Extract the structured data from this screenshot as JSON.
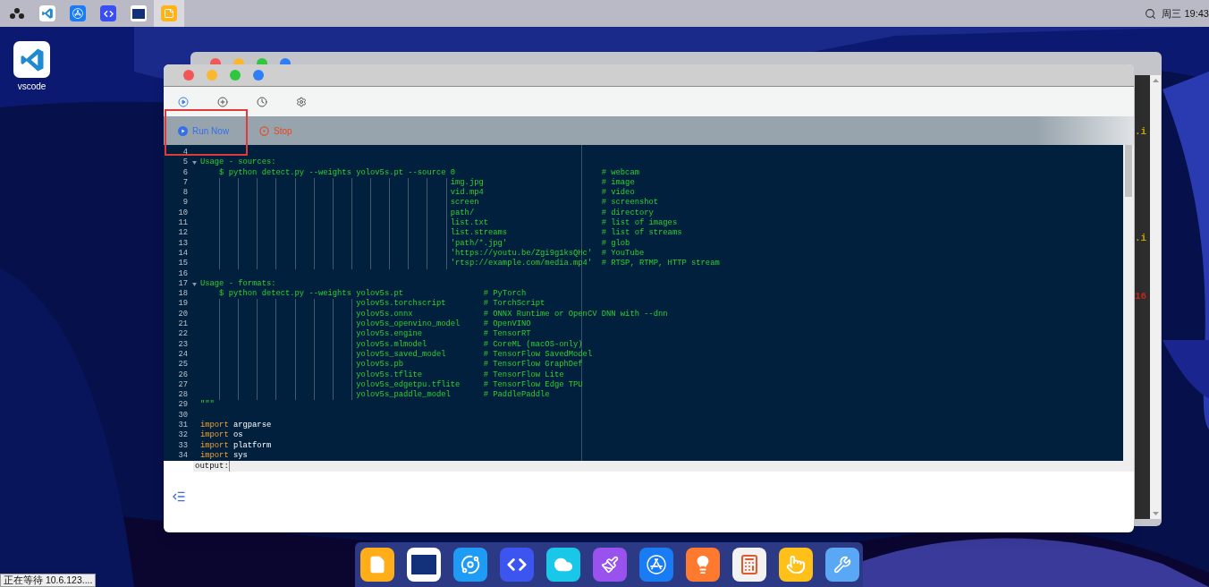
{
  "top_bar": {
    "apps": [
      {
        "kind": "launcher",
        "selected": false
      },
      {
        "kind": "vscode",
        "selected": false
      },
      {
        "kind": "appstore",
        "selected": false
      },
      {
        "kind": "code",
        "selected": false
      },
      {
        "kind": "terminal",
        "selected": false
      },
      {
        "kind": "notes",
        "selected": true
      }
    ],
    "clock": "周三 19:43"
  },
  "desktop_icons": [
    {
      "kind": "vscode",
      "label": "vscode"
    }
  ],
  "back_window": {
    "fragments": [
      {
        "text": ".i",
        "kind": "string"
      },
      {
        "text": ".i",
        "kind": "string"
      },
      {
        "text": "16",
        "kind": "number"
      }
    ]
  },
  "window": {
    "toolbar": [
      {
        "kind": "run",
        "selected": true
      },
      {
        "kind": "add",
        "selected": false
      },
      {
        "kind": "history",
        "selected": false
      },
      {
        "kind": "settings",
        "selected": false
      }
    ],
    "actions": [
      {
        "kind": "run",
        "label": "Run Now"
      },
      {
        "kind": "stop",
        "label": "Stop"
      }
    ],
    "editor": {
      "lines": [
        {
          "n": "4",
          "fold": false
        },
        {
          "n": "5",
          "fold": true,
          "segments": [
            {
              "kind": "doc",
              "text": "Usage - sources:"
            }
          ]
        },
        {
          "n": "6",
          "fold": false,
          "segments": [
            {
              "kind": "doc",
              "text": "    $ python detect.py --weights yolov5s.pt --source 0                               # webcam"
            }
          ]
        },
        {
          "n": "7",
          "fold": false,
          "segments": [
            {
              "kind": "doc",
              "text": "                                                     img.jpg                         # image"
            }
          ]
        },
        {
          "n": "8",
          "fold": false,
          "segments": [
            {
              "kind": "doc",
              "text": "                                                     vid.mp4                         # video"
            }
          ]
        },
        {
          "n": "9",
          "fold": false,
          "segments": [
            {
              "kind": "doc",
              "text": "                                                     screen                          # screenshot"
            }
          ]
        },
        {
          "n": "10",
          "fold": false,
          "segments": [
            {
              "kind": "doc",
              "text": "                                                     path/                           # directory"
            }
          ]
        },
        {
          "n": "11",
          "fold": false,
          "segments": [
            {
              "kind": "doc",
              "text": "                                                     list.txt                        # list of images"
            }
          ]
        },
        {
          "n": "12",
          "fold": false,
          "segments": [
            {
              "kind": "doc",
              "text": "                                                     list.streams                    # list of streams"
            }
          ]
        },
        {
          "n": "13",
          "fold": false,
          "segments": [
            {
              "kind": "doc",
              "text": "                                                     'path/*.jpg'                    # glob"
            }
          ]
        },
        {
          "n": "14",
          "fold": false,
          "segments": [
            {
              "kind": "doc",
              "text": "                                                     'https://youtu.be/Zgi9g1ksQHc'  # YouTube"
            }
          ]
        },
        {
          "n": "15",
          "fold": false,
          "segments": [
            {
              "kind": "doc",
              "text": "                                                     'rtsp://example.com/media.mp4'  # RTSP, RTMP, HTTP stream"
            }
          ]
        },
        {
          "n": "16",
          "fold": false
        },
        {
          "n": "17",
          "fold": true,
          "segments": [
            {
              "kind": "doc",
              "text": "Usage - formats:"
            }
          ]
        },
        {
          "n": "18",
          "fold": false,
          "segments": [
            {
              "kind": "doc",
              "text": "    $ python detect.py --weights yolov5s.pt                 # PyTorch"
            }
          ]
        },
        {
          "n": "19",
          "fold": false,
          "segments": [
            {
              "kind": "doc",
              "text": "                                 yolov5s.torchscript        # TorchScript"
            }
          ]
        },
        {
          "n": "20",
          "fold": false,
          "segments": [
            {
              "kind": "doc",
              "text": "                                 yolov5s.onnx               # ONNX Runtime or OpenCV DNN with --dnn"
            }
          ]
        },
        {
          "n": "21",
          "fold": false,
          "segments": [
            {
              "kind": "doc",
              "text": "                                 yolov5s_openvino_model     # OpenVINO"
            }
          ]
        },
        {
          "n": "22",
          "fold": false,
          "segments": [
            {
              "kind": "doc",
              "text": "                                 yolov5s.engine             # TensorRT"
            }
          ]
        },
        {
          "n": "23",
          "fold": false,
          "segments": [
            {
              "kind": "doc",
              "text": "                                 yolov5s.mlmodel            # CoreML (macOS-only)"
            }
          ]
        },
        {
          "n": "24",
          "fold": false,
          "segments": [
            {
              "kind": "doc",
              "text": "                                 yolov5s_saved_model        # TensorFlow SavedModel"
            }
          ]
        },
        {
          "n": "25",
          "fold": false,
          "segments": [
            {
              "kind": "doc",
              "text": "                                 yolov5s.pb                 # TensorFlow GraphDef"
            }
          ]
        },
        {
          "n": "26",
          "fold": false,
          "segments": [
            {
              "kind": "doc",
              "text": "                                 yolov5s.tflite             # TensorFlow Lite"
            }
          ]
        },
        {
          "n": "27",
          "fold": false,
          "segments": [
            {
              "kind": "doc",
              "text": "                                 yolov5s_edgetpu.tflite     # TensorFlow Edge TPU"
            }
          ]
        },
        {
          "n": "28",
          "fold": false,
          "segments": [
            {
              "kind": "doc",
              "text": "                                 yolov5s_paddle_model       # PaddlePaddle"
            }
          ]
        },
        {
          "n": "29",
          "fold": false,
          "segments": [
            {
              "kind": "doc",
              "text": "\"\"\""
            }
          ]
        },
        {
          "n": "30",
          "fold": false
        },
        {
          "n": "31",
          "fold": false,
          "segments": [
            {
              "kind": "keyword",
              "text": "import"
            },
            {
              "kind": "name",
              "text": "argparse"
            }
          ]
        },
        {
          "n": "32",
          "fold": false,
          "segments": [
            {
              "kind": "keyword",
              "text": "import"
            },
            {
              "kind": "name",
              "text": "os"
            }
          ]
        },
        {
          "n": "33",
          "fold": false,
          "segments": [
            {
              "kind": "keyword",
              "text": "import"
            },
            {
              "kind": "name",
              "text": "platform"
            }
          ]
        },
        {
          "n": "34",
          "fold": false,
          "segments": [
            {
              "kind": "keyword",
              "text": "import"
            },
            {
              "kind": "name",
              "text": "sys"
            }
          ]
        }
      ]
    },
    "output": {
      "label": "output:"
    }
  },
  "status_text": "正在等待 10.6.123....",
  "dock": [
    {
      "kind": "files"
    },
    {
      "kind": "terminal"
    },
    {
      "kind": "planet"
    },
    {
      "kind": "code"
    },
    {
      "kind": "cloud"
    },
    {
      "kind": "brush"
    },
    {
      "kind": "appstore"
    },
    {
      "kind": "bulb"
    },
    {
      "kind": "calculator"
    },
    {
      "kind": "touch"
    },
    {
      "kind": "tools"
    }
  ]
}
